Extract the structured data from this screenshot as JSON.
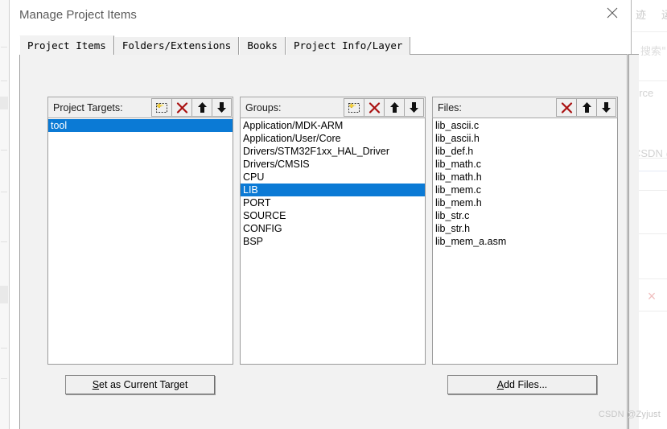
{
  "dialog": {
    "title": "Manage Project Items",
    "close_icon": "close-icon"
  },
  "tabs": [
    {
      "label": "Project Items",
      "active": true
    },
    {
      "label": "Folders/Extensions",
      "active": false
    },
    {
      "label": "Books",
      "active": false
    },
    {
      "label": "Project Info/Layer",
      "active": false
    }
  ],
  "columns": {
    "project_targets": {
      "label": "Project Targets:",
      "buttons": [
        {
          "icon": "new-item-icon",
          "name": "new-target-button"
        },
        {
          "icon": "delete-x-icon",
          "name": "delete-target-button"
        },
        {
          "icon": "move-up-icon",
          "name": "move-target-up-button"
        },
        {
          "icon": "move-down-icon",
          "name": "move-target-down-button"
        }
      ],
      "items": [
        {
          "label": "tool",
          "selected": true
        }
      ]
    },
    "groups": {
      "label": "Groups:",
      "buttons": [
        {
          "icon": "new-item-icon",
          "name": "new-group-button"
        },
        {
          "icon": "delete-x-icon",
          "name": "delete-group-button"
        },
        {
          "icon": "move-up-icon",
          "name": "move-group-up-button"
        },
        {
          "icon": "move-down-icon",
          "name": "move-group-down-button"
        }
      ],
      "items": [
        {
          "label": "Application/MDK-ARM",
          "selected": false
        },
        {
          "label": "Application/User/Core",
          "selected": false
        },
        {
          "label": "Drivers/STM32F1xx_HAL_Driver",
          "selected": false
        },
        {
          "label": "Drivers/CMSIS",
          "selected": false
        },
        {
          "label": "CPU",
          "selected": false
        },
        {
          "label": "LIB",
          "selected": true
        },
        {
          "label": "PORT",
          "selected": false
        },
        {
          "label": "SOURCE",
          "selected": false
        },
        {
          "label": "CONFIG",
          "selected": false
        },
        {
          "label": "BSP",
          "selected": false
        }
      ]
    },
    "files": {
      "label": "Files:",
      "buttons": [
        {
          "icon": "delete-x-icon",
          "name": "delete-file-button"
        },
        {
          "icon": "move-up-icon",
          "name": "move-file-up-button"
        },
        {
          "icon": "move-down-icon",
          "name": "move-file-down-button"
        }
      ],
      "items": [
        {
          "label": "lib_ascii.c",
          "selected": false
        },
        {
          "label": "lib_ascii.h",
          "selected": false
        },
        {
          "label": "lib_def.h",
          "selected": false
        },
        {
          "label": "lib_math.c",
          "selected": false
        },
        {
          "label": "lib_math.h",
          "selected": false
        },
        {
          "label": "lib_mem.c",
          "selected": false
        },
        {
          "label": "lib_mem.h",
          "selected": false
        },
        {
          "label": "lib_str.c",
          "selected": false
        },
        {
          "label": "lib_str.h",
          "selected": false
        },
        {
          "label": "lib_mem_a.asm",
          "selected": false
        }
      ]
    }
  },
  "buttons": {
    "set_as_current_target": {
      "prefix": "S",
      "rest": "et as Current Target"
    },
    "add_files": {
      "prefix": "A",
      "rest": "dd Files..."
    }
  },
  "background": {
    "cjk_1": "迹",
    "cjk_2": "运",
    "search_label": "搜索\"",
    "source_fragment": "urce",
    "csdn_fragment": "CSDN @",
    "x_icon": "×"
  },
  "watermark": "CSDN @Zyjust",
  "colors": {
    "selection_blue": "#0b7ad5",
    "delete_red": "#aa1111",
    "dialog_face": "#f2f2f2",
    "title_gray": "#5c5c5c",
    "watermark_gray": "#c6c6c6"
  }
}
